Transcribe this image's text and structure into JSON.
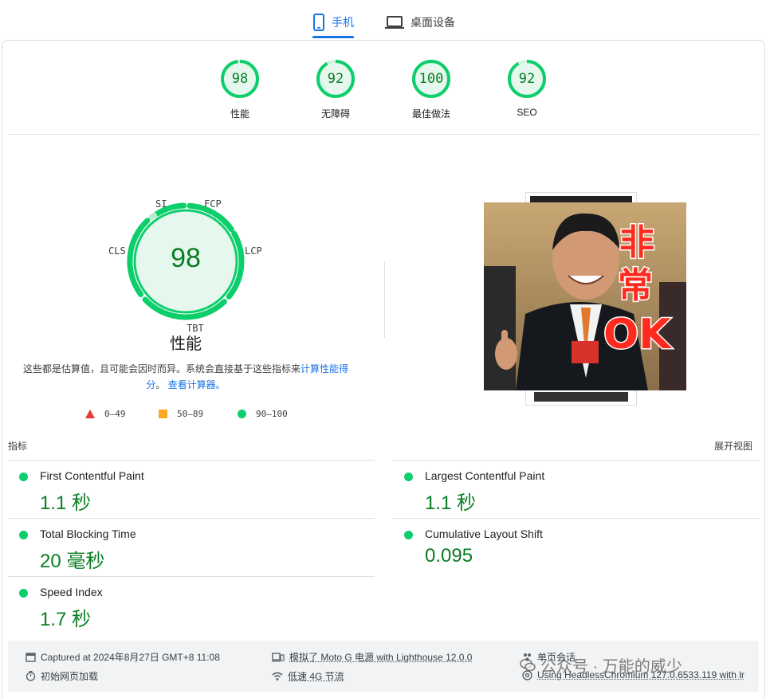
{
  "tabs": {
    "mobile_label": "手机",
    "desktop_label": "桌面设备"
  },
  "categories": [
    {
      "score": "98",
      "label": "性能",
      "value": 0.98
    },
    {
      "score": "92",
      "label": "无障碍",
      "value": 0.92
    },
    {
      "score": "100",
      "label": "最佳做法",
      "value": 1.0
    },
    {
      "score": "92",
      "label": "SEO",
      "value": 0.92
    }
  ],
  "performance": {
    "score": "98",
    "title": "性能",
    "gauge_labels": {
      "si": "SI",
      "fcp": "FCP",
      "lcp": "LCP",
      "cls": "CLS",
      "tbt": "TBT"
    },
    "description_prefix": "这些都是估算值，且可能会因时而异。系统会直接基于这些指标来",
    "description_link1": "计算性能得分",
    "description_sep": "。",
    "description_link2": "查看计算器。",
    "legend": {
      "fail": "0–49",
      "average": "50–89",
      "pass": "90–100"
    }
  },
  "screenshot": {
    "overlay_line1": "非",
    "overlay_line2": "常",
    "overlay_line3": "OK"
  },
  "metrics": {
    "title": "指标",
    "expand_label": "展开视图",
    "items": [
      {
        "name": "First Contentful Paint",
        "value": "1.1 秒"
      },
      {
        "name": "Largest Contentful Paint",
        "value": "1.1 秒"
      },
      {
        "name": "Total Blocking Time",
        "value": "20 毫秒"
      },
      {
        "name": "Cumulative Layout Shift",
        "value": "0.095"
      },
      {
        "name": "Speed Index",
        "value": "1.7 秒"
      }
    ]
  },
  "footer": {
    "captured": "Captured at 2024年8月27日 GMT+8 11:08",
    "initial_load": "初始网页加载",
    "emulated": "模拟了 Moto G 电源 with Lighthouse 12.0.0",
    "throttling": "低速 4G 节流",
    "session": "单页会话",
    "browser": "Using HeadlessChromium 127.0.6533.119 with lr"
  },
  "watermark": "公众号 · 万能的威少",
  "colors": {
    "pass": "#0cce6b",
    "pass_text": "#0a7d24",
    "accent": "#1a73e8",
    "average": "#ffa726",
    "fail": "#e53935"
  }
}
